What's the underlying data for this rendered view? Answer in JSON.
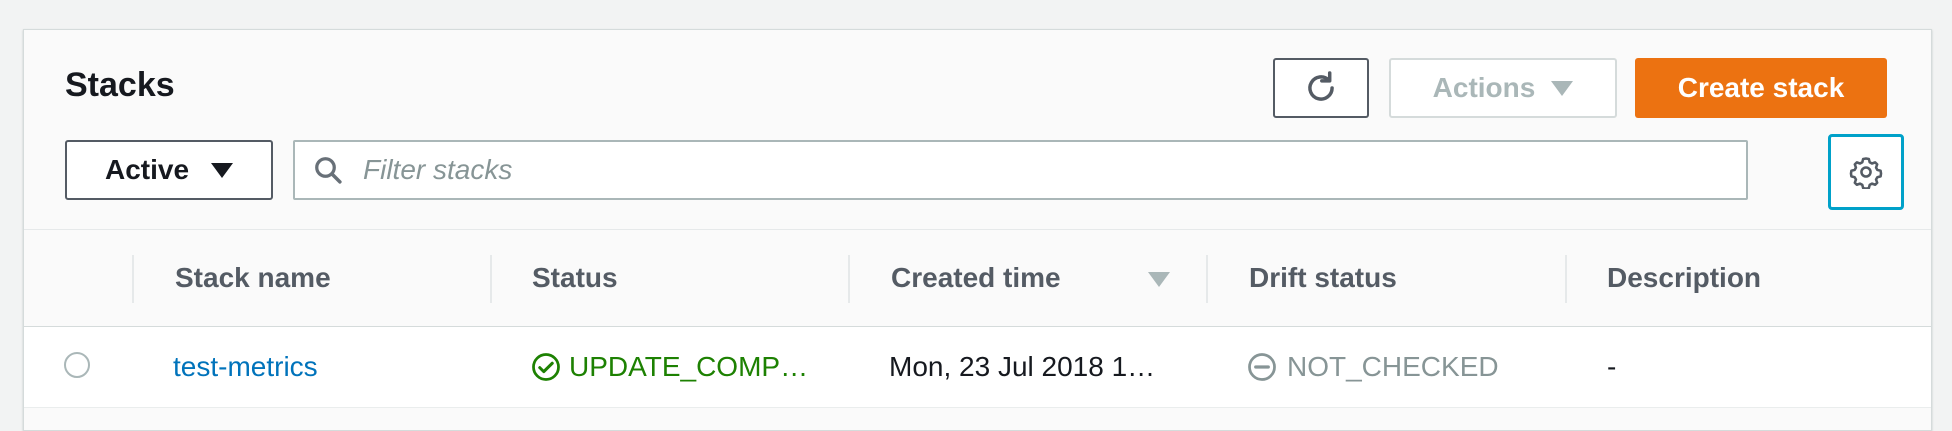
{
  "panel": {
    "title": "Stacks",
    "refresh_icon": "refresh-icon",
    "actions_label": "Actions",
    "create_label": "Create stack",
    "filter_select_value": "Active",
    "filter_placeholder": "Filter stacks",
    "settings_icon": "gear-icon"
  },
  "table": {
    "columns": [
      "Stack name",
      "Status",
      "Created time",
      "Drift status",
      "Description"
    ],
    "sorted_column": "Created time",
    "rows": [
      {
        "stack_name": "test-metrics",
        "status": "UPDATE_COMP…",
        "created_time": "Mon, 23 Jul 2018 1…",
        "drift_status": "NOT_CHECKED",
        "description": "-"
      }
    ]
  },
  "colors": {
    "accent": "#ec7211",
    "link": "#0073bb",
    "success": "#1d8102",
    "focus": "#00a1c9"
  }
}
